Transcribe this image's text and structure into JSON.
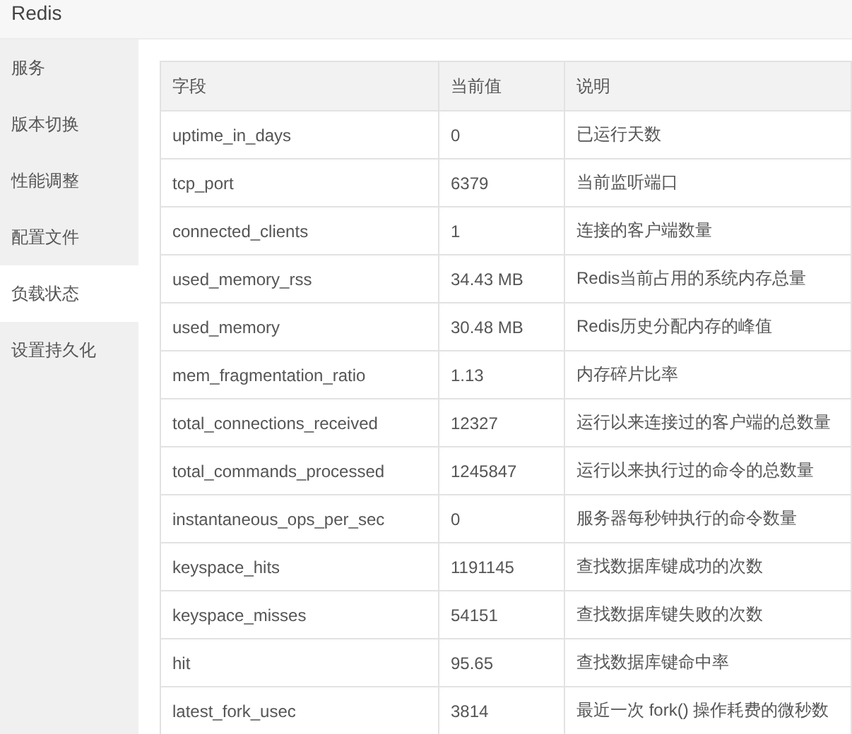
{
  "window": {
    "title": "Redis"
  },
  "sidebar": {
    "items": [
      {
        "label": "服务",
        "selected": false
      },
      {
        "label": "版本切换",
        "selected": false
      },
      {
        "label": "性能调整",
        "selected": false
      },
      {
        "label": "配置文件",
        "selected": false
      },
      {
        "label": "负载状态",
        "selected": true
      },
      {
        "label": "设置持久化",
        "selected": false
      }
    ]
  },
  "table": {
    "columns": [
      "字段",
      "当前值",
      "说明"
    ],
    "rows": [
      [
        "uptime_in_days",
        "0",
        "已运行天数"
      ],
      [
        "tcp_port",
        "6379",
        "当前监听端口"
      ],
      [
        "connected_clients",
        "1",
        "连接的客户端数量"
      ],
      [
        "used_memory_rss",
        "34.43 MB",
        "Redis当前占用的系统内存总量"
      ],
      [
        "used_memory",
        "30.48 MB",
        "Redis历史分配内存的峰值"
      ],
      [
        "mem_fragmentation_ratio",
        "1.13",
        "内存碎片比率"
      ],
      [
        "total_connections_received",
        "12327",
        "运行以来连接过的客户端的总数量"
      ],
      [
        "total_commands_processed",
        "1245847",
        "运行以来执行过的命令的总数量"
      ],
      [
        "instantaneous_ops_per_sec",
        "0",
        "服务器每秒钟执行的命令数量"
      ],
      [
        "keyspace_hits",
        "1191145",
        "查找数据库键成功的次数"
      ],
      [
        "keyspace_misses",
        "54151",
        "查找数据库键失败的次数"
      ],
      [
        "hit",
        "95.65",
        "查找数据库键命中率"
      ],
      [
        "latest_fork_usec",
        "3814",
        "最近一次 fork() 操作耗费的微秒数"
      ]
    ]
  }
}
